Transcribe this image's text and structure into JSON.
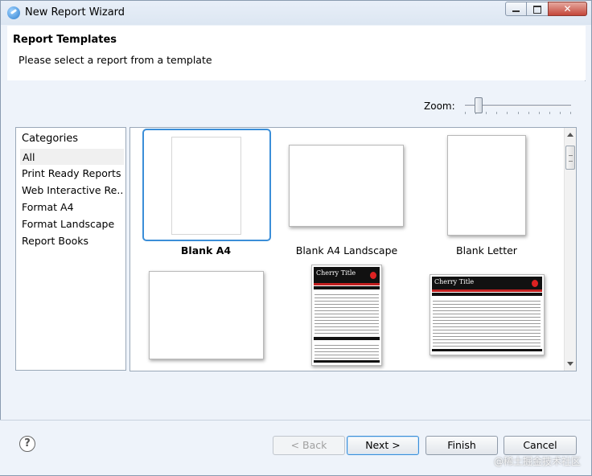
{
  "window": {
    "title": "New Report Wizard"
  },
  "header": {
    "title": "Report Templates",
    "subtitle": "Please select a report from a template"
  },
  "zoom": {
    "label": "Zoom:",
    "level": 0.1
  },
  "categories": {
    "header": "Categories",
    "items": [
      {
        "label": "All",
        "selected": true
      },
      {
        "label": "Print Ready Reports"
      },
      {
        "label": "Web Interactive Re..."
      },
      {
        "label": "Format A4"
      },
      {
        "label": "Format Landscape"
      },
      {
        "label": "Report Books"
      }
    ]
  },
  "templates": [
    {
      "label": "Blank A4",
      "selected": true
    },
    {
      "label": "Blank A4 Landscape"
    },
    {
      "label": "Blank Letter"
    },
    {
      "label": ""
    },
    {
      "label": "",
      "preview_title": "Cherry Title"
    },
    {
      "label": "",
      "preview_title": "Cherry Title"
    }
  ],
  "footer": {
    "back": "< Back",
    "next": "Next >",
    "finish": "Finish",
    "cancel": "Cancel"
  },
  "watermark": "@稀土掘金技术社区",
  "colors": {
    "selection": "#3b8ed8",
    "cherry_red": "#c21f1f"
  }
}
